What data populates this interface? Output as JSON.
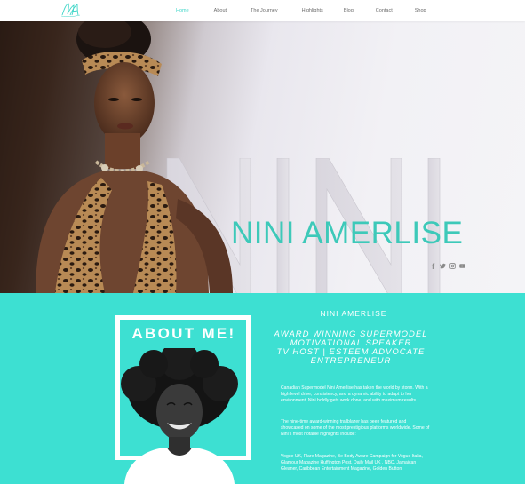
{
  "header": {
    "logo_text": "NA",
    "nav": [
      {
        "label": "Home",
        "active": true
      },
      {
        "label": "About",
        "active": false
      },
      {
        "label": "The Journey",
        "active": false
      },
      {
        "label": "Highlights",
        "active": false
      },
      {
        "label": "Blog",
        "active": false
      },
      {
        "label": "Contact",
        "active": false
      },
      {
        "label": "Shop",
        "active": false
      }
    ]
  },
  "hero": {
    "title": "NINI AMERLISE",
    "background_letters": "NINI",
    "social_icons": [
      "facebook-icon",
      "twitter-icon",
      "instagram-icon",
      "youtube-icon"
    ]
  },
  "about": {
    "heading": "ABOUT ME!",
    "name": "NINI AMERLISE",
    "roles": [
      "AWARD WINNING SUPERMODEL",
      "MOTIVATIONAL SPEAKER",
      "TV HOST | ESTEEM ADVOCATE",
      "ENTREPRENEUR"
    ],
    "paragraphs": [
      "Canadian Supermodel Nini Amerlise has taken the world by storm. With a high level drive, consistency, and a dynamic ability to adapt to her environment, Nini boldly gets work done, and with maximum results.",
      "The nine-time award-winning trailblazer has been featured and showcased on some of the most prestigious platforms worldwide. Some of Nini's most notable highlights include:",
      "Vogue UK, Flare Magazine, Be Body Aware Campaign for Vogue Italia, Glamour Magazine Huffington Post, Daily Mail UK , NBC, Jamaican Gleaner, Caribbean Entertainment Magazine, Golden Button"
    ]
  },
  "colors": {
    "accent": "#3fd6c8",
    "teal_section": "#3de0d2",
    "nav_text": "#6b6b6b",
    "white": "#ffffff"
  }
}
